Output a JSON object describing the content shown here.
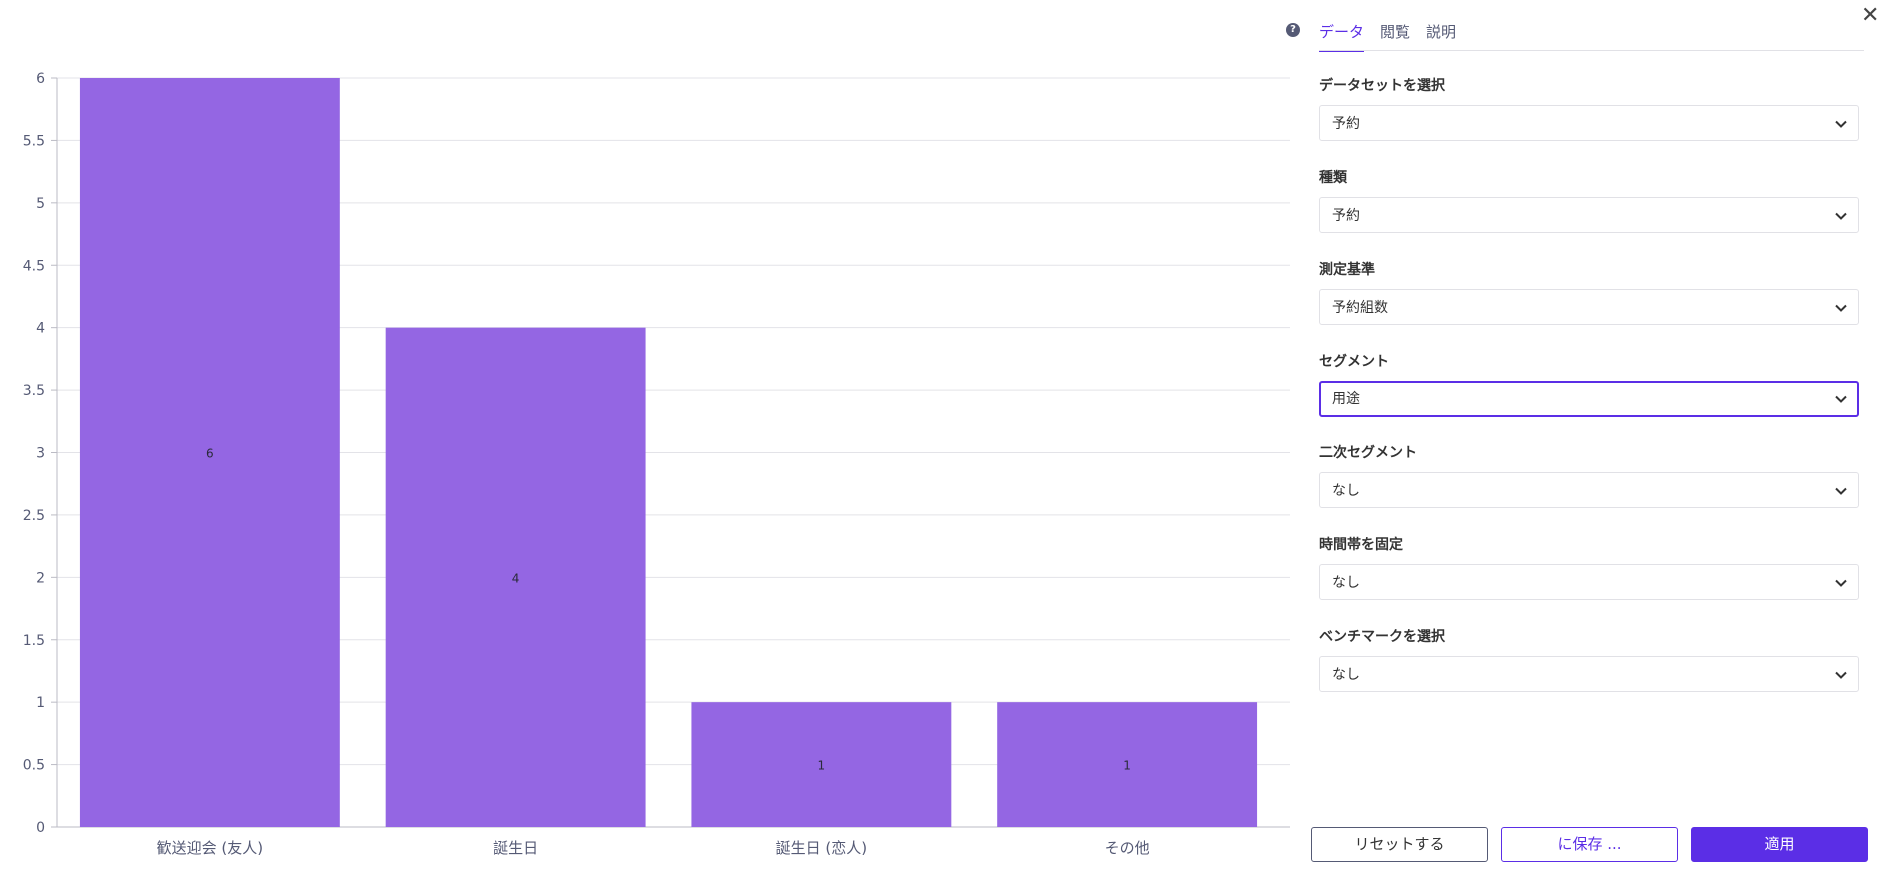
{
  "chart_data": {
    "type": "bar",
    "categories": [
      "歓送迎会 (友人)",
      "誕生日",
      "誕生日 (恋人)",
      "その他"
    ],
    "values": [
      6,
      4,
      1,
      1
    ],
    "y_ticks": [
      "0",
      "0.5",
      "1",
      "1.5",
      "2",
      "2.5",
      "3",
      "3.5",
      "4",
      "4.5",
      "5",
      "5.5",
      "6"
    ],
    "ylim": [
      0,
      6
    ],
    "bar_color": "#9466e3",
    "grid": true,
    "xlabel": "",
    "ylabel": ""
  },
  "panel": {
    "help_icon": "question-circle-icon",
    "tabs": [
      {
        "label": "データ",
        "active": true
      },
      {
        "label": "閲覧",
        "active": false
      },
      {
        "label": "説明",
        "active": false
      }
    ],
    "close_icon": "close-icon",
    "fields": [
      {
        "label": "データセットを選択",
        "value": "予約"
      },
      {
        "label": "種類",
        "value": "予約"
      },
      {
        "label": "測定基準",
        "value": "予約組数"
      },
      {
        "label": "セグメント",
        "value": "用途"
      },
      {
        "label": "二次セグメント",
        "value": "なし"
      },
      {
        "label": "時間帯を固定",
        "value": "なし"
      },
      {
        "label": "ベンチマークを選択",
        "value": "なし"
      }
    ],
    "buttons": {
      "reset": "リセットする",
      "save": "に保存 ...",
      "apply": "適用"
    },
    "accent_color": "#5b2ee6"
  }
}
